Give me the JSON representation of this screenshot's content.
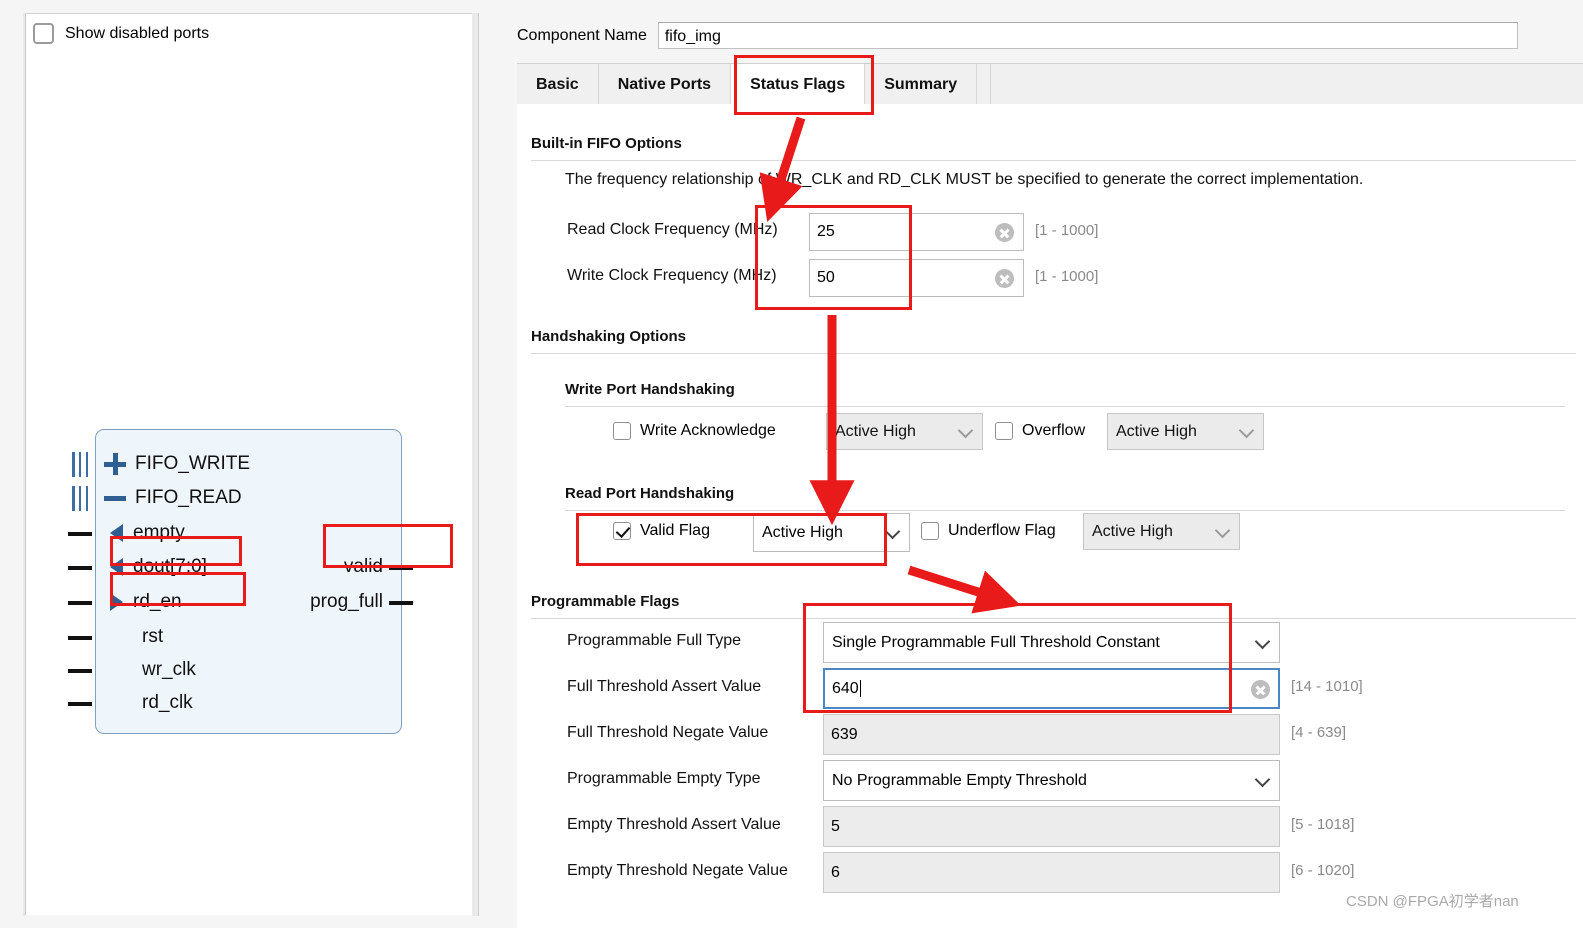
{
  "left_panel": {
    "show_disabled_ports": {
      "label": "Show disabled ports",
      "checked": false
    },
    "symbol": {
      "bus_ports": [
        {
          "name": "FIFO_WRITE",
          "icon": "plus-icon"
        },
        {
          "name": "FIFO_READ",
          "icon": "minus-icon"
        }
      ],
      "input_ports": [
        {
          "name": "empty",
          "icon": "triangle-left-icon"
        },
        {
          "name": "dout[7:0]",
          "icon": "triangle-left-icon"
        },
        {
          "name": "rd_en",
          "icon": "triangle-right-icon"
        },
        {
          "name": "rst",
          "icon": "none"
        },
        {
          "name": "wr_clk",
          "icon": "none"
        },
        {
          "name": "rd_clk",
          "icon": "none"
        }
      ],
      "output_ports": [
        {
          "name": "valid"
        },
        {
          "name": "prog_full"
        }
      ]
    }
  },
  "header": {
    "component_name_label": "Component Name",
    "component_name_value": "fifo_img"
  },
  "tabs": [
    {
      "label": "Basic",
      "selected": false
    },
    {
      "label": "Native Ports",
      "selected": false
    },
    {
      "label": "Status Flags",
      "selected": true
    },
    {
      "label": "Summary",
      "selected": false
    }
  ],
  "builtin_fifo": {
    "section_title": "Built-in FIFO Options",
    "description": "The frequency relationship of WR_CLK and RD_CLK MUST be specified to generate the correct implementation.",
    "fields": [
      {
        "label": "Read Clock Frequency (MHz)",
        "value": "25",
        "range": "[1 - 1000]"
      },
      {
        "label": "Write Clock Frequency (MHz)",
        "value": "50",
        "range": "[1 - 1000]"
      }
    ]
  },
  "handshaking": {
    "section_title": "Handshaking Options",
    "write_port": {
      "title": "Write Port Handshaking",
      "items": [
        {
          "label": "Write Acknowledge",
          "checked": false,
          "polarity": "Active High",
          "enabled": false
        },
        {
          "label": "Overflow",
          "checked": false,
          "polarity": "Active High",
          "enabled": false
        }
      ]
    },
    "read_port": {
      "title": "Read Port Handshaking",
      "items": [
        {
          "label": "Valid Flag",
          "checked": true,
          "polarity": "Active High",
          "enabled": true
        },
        {
          "label": "Underflow Flag",
          "checked": false,
          "polarity": "Active High",
          "enabled": false
        }
      ]
    }
  },
  "programmable_flags": {
    "section_title": "Programmable Flags",
    "rows": [
      {
        "label": "Programmable Full Type",
        "kind": "select",
        "value": "Single Programmable Full Threshold Constant",
        "range": "",
        "enabled": true
      },
      {
        "label": "Full Threshold Assert Value",
        "kind": "text",
        "value": "640",
        "range": "[14 - 1010]",
        "enabled": true,
        "focused": true
      },
      {
        "label": "Full Threshold Negate Value",
        "kind": "text",
        "value": "639",
        "range": "[4 - 639]",
        "enabled": false
      },
      {
        "label": "Programmable Empty Type",
        "kind": "select",
        "value": "No Programmable Empty Threshold",
        "range": "",
        "enabled": true
      },
      {
        "label": "Empty Threshold Assert Value",
        "kind": "text",
        "value": "5",
        "range": "[5 - 1018]",
        "enabled": false
      },
      {
        "label": "Empty Threshold Negate Value",
        "kind": "text",
        "value": "6",
        "range": "[6 - 1020]",
        "enabled": false
      }
    ]
  },
  "annotation": {
    "color": "#e81a1a",
    "boxes": [
      "status-flags-tab",
      "clock-frequency-inputs",
      "valid-flag-row",
      "dout-port",
      "rd_en-port",
      "valid-output-port",
      "programmable-full-threshold"
    ],
    "arrows": [
      "tab-to-clock-arrow",
      "clock-to-read-port-arrow",
      "valid-flag-to-prog-flags-arrow"
    ]
  },
  "watermark": {
    "text": "CSDN @FPGA初学者nan"
  }
}
